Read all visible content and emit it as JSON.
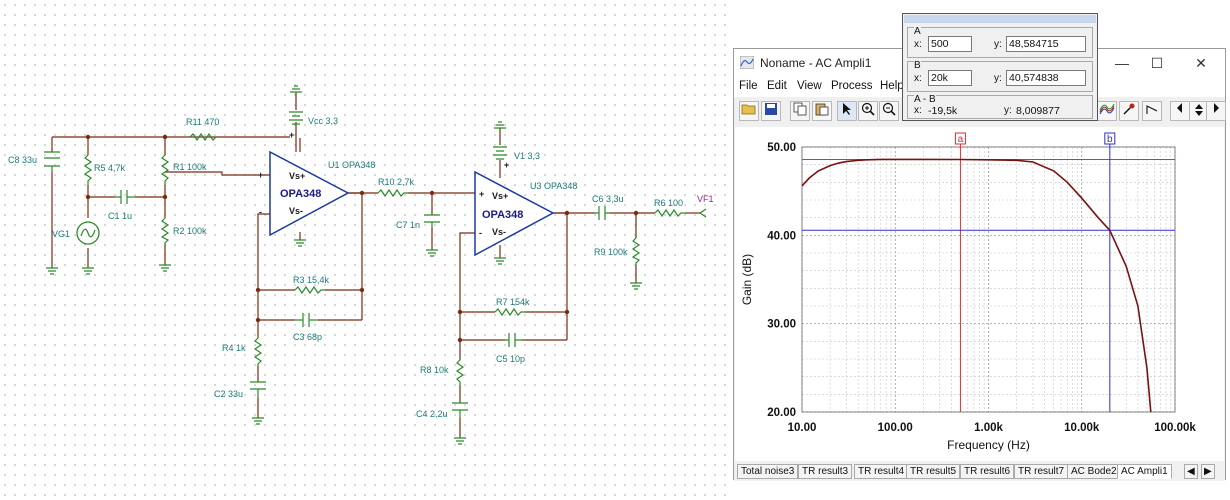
{
  "schematic": {
    "labels": {
      "c8": "C8 33u",
      "r5": "R5 4,7k",
      "r11": "R11 470",
      "vcc": "Vcc 3,3",
      "r1": "R1 100k",
      "c1": "C1 1u",
      "r2": "R2 100k",
      "vg1": "VG1",
      "u1": "U1 OPA348",
      "u1_name": "OPA348",
      "vs_plus": "Vs+",
      "vs_minus": "Vs-",
      "plus": "+",
      "minus": "-",
      "r10": "R10 2,7k",
      "c7": "C7 1n",
      "v1": "V1 3,3",
      "u3": "U3 OPA348",
      "u3_name": "OPA348",
      "c6": "C6 3,3u",
      "r6": "R6 100",
      "vf1": "VF1",
      "r9": "R9 100k",
      "r3": "R3 15,4k",
      "c3": "C3 68p",
      "r4": "R4 1k",
      "c2": "C2 33u",
      "r7": "R7 154k",
      "c5": "C5 10p",
      "r8": "R8 10k",
      "c4": "C4 2,2u"
    }
  },
  "window": {
    "title": "Noname - AC Ampli1",
    "controls": {
      "minimize": "—",
      "maximize": "☐",
      "close": "✕"
    },
    "menu": [
      "File",
      "Edit",
      "View",
      "Process",
      "Help"
    ]
  },
  "cursors": {
    "a": {
      "label": "A",
      "x_label": "x:",
      "x": "500",
      "y_label": "y:",
      "y": "48,584715"
    },
    "b": {
      "label": "B",
      "x_label": "x:",
      "x": "20k",
      "y_label": "y:",
      "y": "40,574838"
    },
    "ab": {
      "label": "A - B",
      "x_label": "x:",
      "x": "-19,5k",
      "y_label": "y:",
      "y": "8,009877"
    }
  },
  "tabs": [
    "Total noise3",
    "TR result3",
    "TR result4",
    "TR result5",
    "TR result6",
    "TR result7",
    "AC Bode2",
    "AC Ampli1"
  ],
  "active_tab": "AC Ampli1",
  "chart_data": {
    "type": "line",
    "title": "",
    "xlabel": "Frequency (Hz)",
    "ylabel": "Gain (dB)",
    "xscale": "log",
    "xlim": [
      10,
      100000
    ],
    "ylim": [
      20,
      50
    ],
    "x_tick_labels": [
      "10.00",
      "100.00",
      "1.00k",
      "10.00k",
      "100.00k"
    ],
    "y_tick_labels": [
      "20.00",
      "30.00",
      "40.00",
      "50.00"
    ],
    "grid": true,
    "series": [
      {
        "color": "#7a1010",
        "x": [
          10,
          12,
          15,
          20,
          25,
          30,
          40,
          50,
          70,
          100,
          200,
          500,
          1000,
          2000,
          3000,
          5000,
          7000,
          10000,
          15000,
          20000,
          30000,
          40000,
          50000,
          55000
        ],
        "y": [
          45.6,
          46.5,
          47.3,
          47.9,
          48.2,
          48.35,
          48.5,
          48.55,
          48.6,
          48.6,
          48.6,
          48.58,
          48.55,
          48.5,
          48.3,
          47.3,
          46.0,
          44.2,
          42.0,
          40.57,
          36.5,
          32.0,
          25.0,
          20.0
        ]
      }
    ],
    "cursor_a": {
      "x": 500,
      "y": 48.584715,
      "label": "a",
      "color": "#e03030"
    },
    "cursor_b": {
      "x": 20000,
      "y": 40.574838,
      "label": "b",
      "color": "#3030d0"
    }
  }
}
